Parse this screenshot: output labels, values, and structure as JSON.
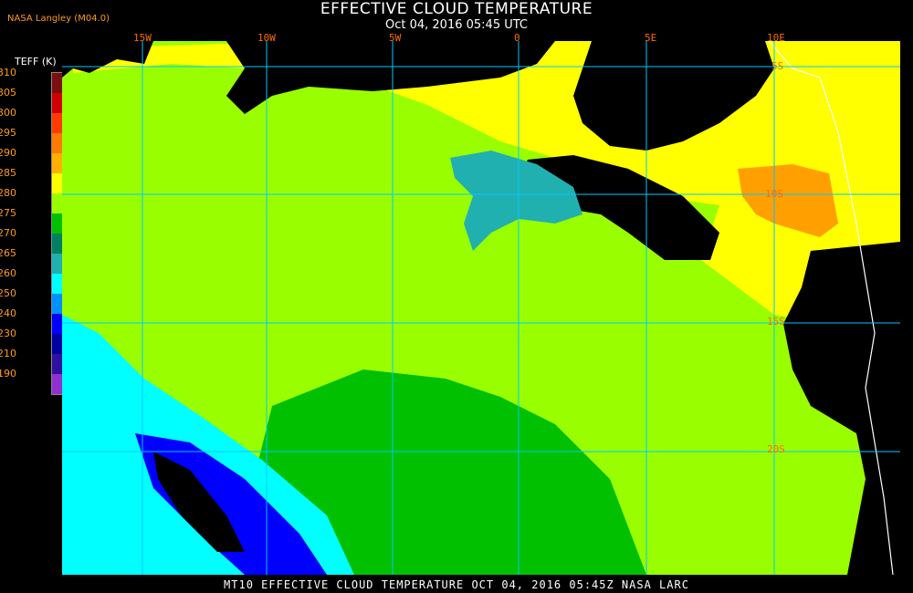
{
  "header": {
    "title": "EFFECTIVE CLOUD TEMPERATURE",
    "subtitle": "Oct 04, 2016 05:45 UTC",
    "credit": "NASA Langley (M04.0)"
  },
  "legend": {
    "label": "TEFF (K)",
    "levels": [
      "310",
      "305",
      "300",
      "295",
      "290",
      "285",
      "280",
      "275",
      "270",
      "265",
      "260",
      "250",
      "240",
      "230",
      "210",
      "190"
    ],
    "colors": [
      "#7a0f0f",
      "#d10000",
      "#ff3a00",
      "#ff7a00",
      "#ffb000",
      "#ffff00",
      "#99ff00",
      "#00c000",
      "#008060",
      "#20b0b0",
      "#00ffff",
      "#0090ff",
      "#0000ff",
      "#0000a0",
      "#3010a0",
      "#9030d0"
    ]
  },
  "map": {
    "lon_labels": [
      "15W",
      "10W",
      "5W",
      "0",
      "5E",
      "10E"
    ],
    "lat_labels": [
      "5S",
      "10S",
      "15S",
      "20S"
    ],
    "gridline_color": "#00c8ff",
    "colors": {
      "clear": "#000000",
      "warm_cloud": "#99ff00",
      "mid_cloud": "#00c000",
      "yellow_cloud": "#ffff00",
      "orange_cloud": "#ffa000",
      "teal_cloud": "#20b0b0",
      "cyan_cloud": "#00ffff",
      "blue_cloud": "#0000ff",
      "coast": "#ffffff"
    }
  },
  "footer": {
    "text": "MT10  EFFECTIVE CLOUD TEMPERATURE   OCT 04, 2016 05:45Z   NASA LARC"
  }
}
